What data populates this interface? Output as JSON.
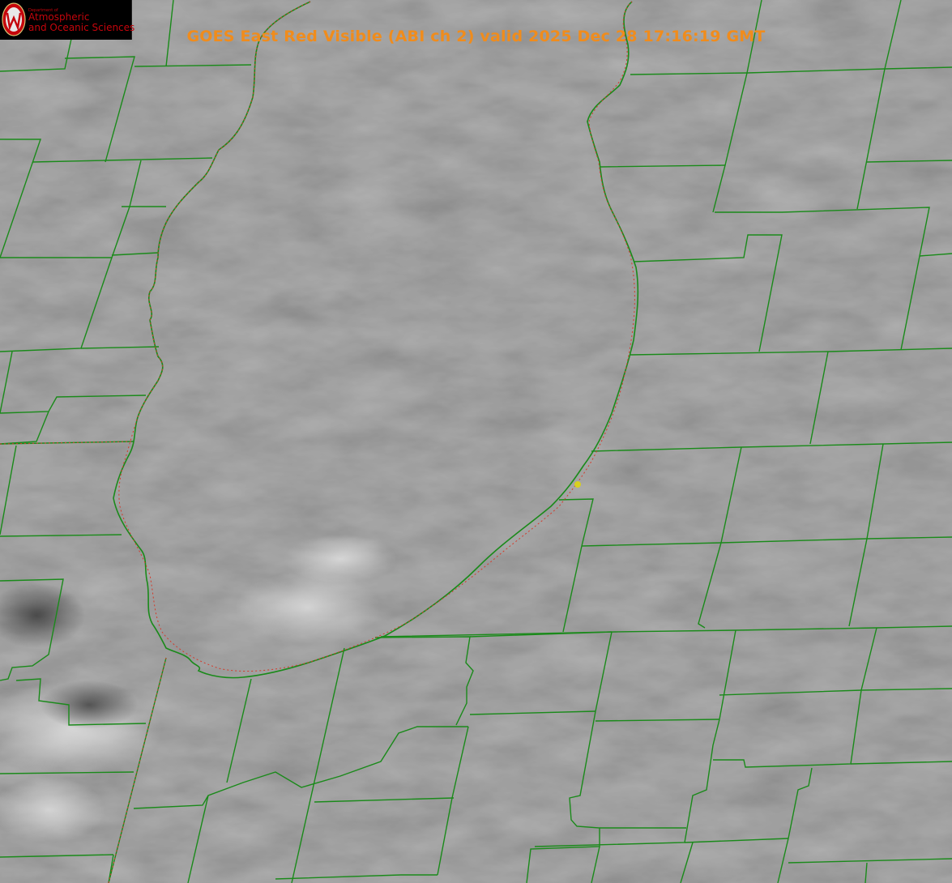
{
  "title": "GOES East Red Visible (ABI ch 2) valid 2025 Dec 28 17:16:19 GMT",
  "logo": {
    "department": "Department of",
    "line1": "Atmospheric",
    "line2": "and Oceanic Sciences",
    "shield_letter": "W"
  },
  "colors": {
    "boundaries": "#1a8a1a",
    "shoreline_dotted": "#d43a2a",
    "title": "#f08c1c",
    "marker": "#d8d020",
    "logo_text": "#c5050c"
  }
}
